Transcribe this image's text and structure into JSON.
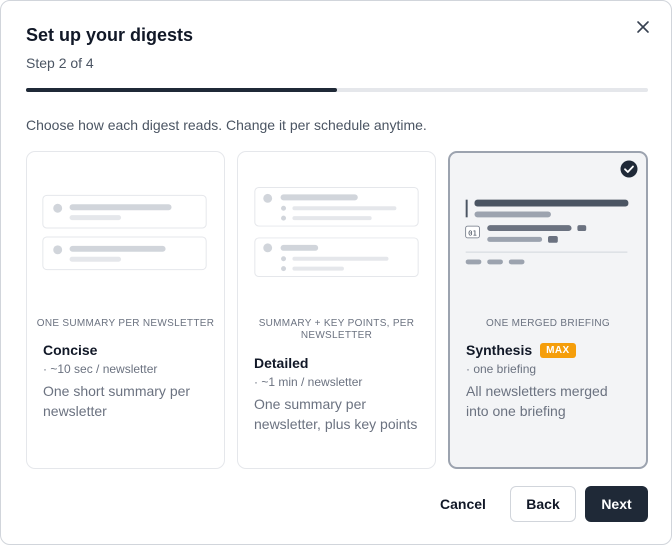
{
  "dialog": {
    "title": "Set up your digests",
    "step": "Step 2 of 4",
    "progress": 0.5,
    "description": "Choose how each digest reads. Change it per schedule anytime."
  },
  "modes": [
    {
      "tag": "ONE SUMMARY PER NEWSLETTER",
      "name": "Concise",
      "meta": "· ~10 sec / newsletter",
      "desc": "One short summary per newsletter",
      "selected": false
    },
    {
      "tag": "SUMMARY + KEY POINTS, PER NEWSLETTER",
      "name": "Detailed",
      "meta": "· ~1 min / newsletter",
      "desc": "One summary per newsletter, plus key points",
      "selected": false
    },
    {
      "tag": "ONE MERGED BRIEFING",
      "name": "Synthesis",
      "badge": "MAX",
      "meta": "· one briefing",
      "desc": "All newsletters merged into one briefing",
      "illustration_number": "01",
      "selected": true
    }
  ],
  "footer": {
    "cancel_label": "Cancel",
    "back_label": "Back",
    "next_label": "Next"
  },
  "colors": {
    "primary": "#1f2937",
    "badge": "#f59e0b",
    "selected_bg": "#f3f4f6",
    "selected_border": "#9ca3af"
  },
  "icons": {
    "close": "close-icon",
    "check": "check-circle-icon"
  }
}
